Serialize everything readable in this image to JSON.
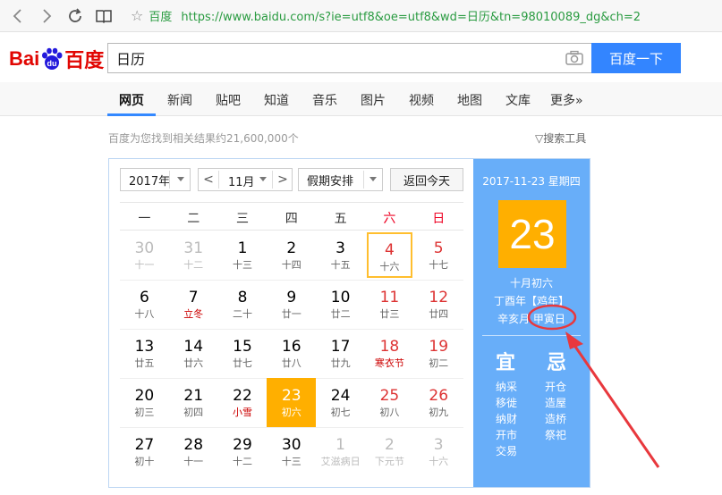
{
  "browser": {
    "site_name": "百度",
    "url": "https://www.baidu.com/s?ie=utf8&oe=utf8&wd=日历&tn=98010089_dg&ch=2"
  },
  "search": {
    "logo_bai": "Bai",
    "logo_du": "du",
    "logo_cn": "百度",
    "query": "日历",
    "button": "百度一下"
  },
  "nav": [
    "网页",
    "新闻",
    "贴吧",
    "知道",
    "音乐",
    "图片",
    "视频",
    "地图",
    "文库",
    "更多»"
  ],
  "result_count": "百度为您找到相关结果约21,600,000个",
  "search_tools": "搜索工具",
  "calendar": {
    "year": "2017年",
    "month": "11月",
    "prev": "<",
    "next": ">",
    "holiday": "假期安排",
    "today": "返回今天",
    "weekdays": [
      "一",
      "二",
      "三",
      "四",
      "五",
      "六",
      "日"
    ],
    "weeks": [
      [
        {
          "n": "30",
          "l": "十一"
        },
        {
          "n": "31",
          "l": "十二"
        },
        {
          "n": "1",
          "l": "十三"
        },
        {
          "n": "2",
          "l": "十四"
        },
        {
          "n": "3",
          "l": "十五"
        },
        {
          "n": "4",
          "l": "十六"
        },
        {
          "n": "5",
          "l": "十七"
        }
      ],
      [
        {
          "n": "6",
          "l": "十八"
        },
        {
          "n": "7",
          "l": "立冬"
        },
        {
          "n": "8",
          "l": "二十"
        },
        {
          "n": "9",
          "l": "廿一"
        },
        {
          "n": "10",
          "l": "廿二"
        },
        {
          "n": "11",
          "l": "廿三"
        },
        {
          "n": "12",
          "l": "廿四"
        }
      ],
      [
        {
          "n": "13",
          "l": "廿五"
        },
        {
          "n": "14",
          "l": "廿六"
        },
        {
          "n": "15",
          "l": "廿七"
        },
        {
          "n": "16",
          "l": "廿八"
        },
        {
          "n": "17",
          "l": "廿九"
        },
        {
          "n": "18",
          "l": "寒衣节"
        },
        {
          "n": "19",
          "l": "初二"
        }
      ],
      [
        {
          "n": "20",
          "l": "初三"
        },
        {
          "n": "21",
          "l": "初四"
        },
        {
          "n": "22",
          "l": "小雪"
        },
        {
          "n": "23",
          "l": "初六"
        },
        {
          "n": "24",
          "l": "初七"
        },
        {
          "n": "25",
          "l": "初八"
        },
        {
          "n": "26",
          "l": "初九"
        }
      ],
      [
        {
          "n": "27",
          "l": "初十"
        },
        {
          "n": "28",
          "l": "十一"
        },
        {
          "n": "29",
          "l": "十二"
        },
        {
          "n": "30",
          "l": "十三"
        },
        {
          "n": "1",
          "l": "艾滋病日"
        },
        {
          "n": "2",
          "l": "下元节"
        },
        {
          "n": "3",
          "l": "十六"
        }
      ]
    ],
    "detail": {
      "date_line": "2017-11-23 星期四",
      "day": "23",
      "lunar": "十月初六",
      "year_gz": "丁酉年【鸡年】",
      "month_gz": "辛亥月",
      "day_gz": "甲寅日",
      "yi_label": "宜",
      "ji_label": "忌",
      "yi_items": [
        "纳采",
        "移徙",
        "纳财",
        "开市",
        "交易"
      ],
      "ji_items": [
        "开仓",
        "造屋",
        "造桥",
        "祭祀"
      ]
    }
  },
  "colors": {
    "accent": "#3385ff",
    "selected": "#ffaf00",
    "panel": "#68aef9",
    "annotation": "#e8383d"
  }
}
